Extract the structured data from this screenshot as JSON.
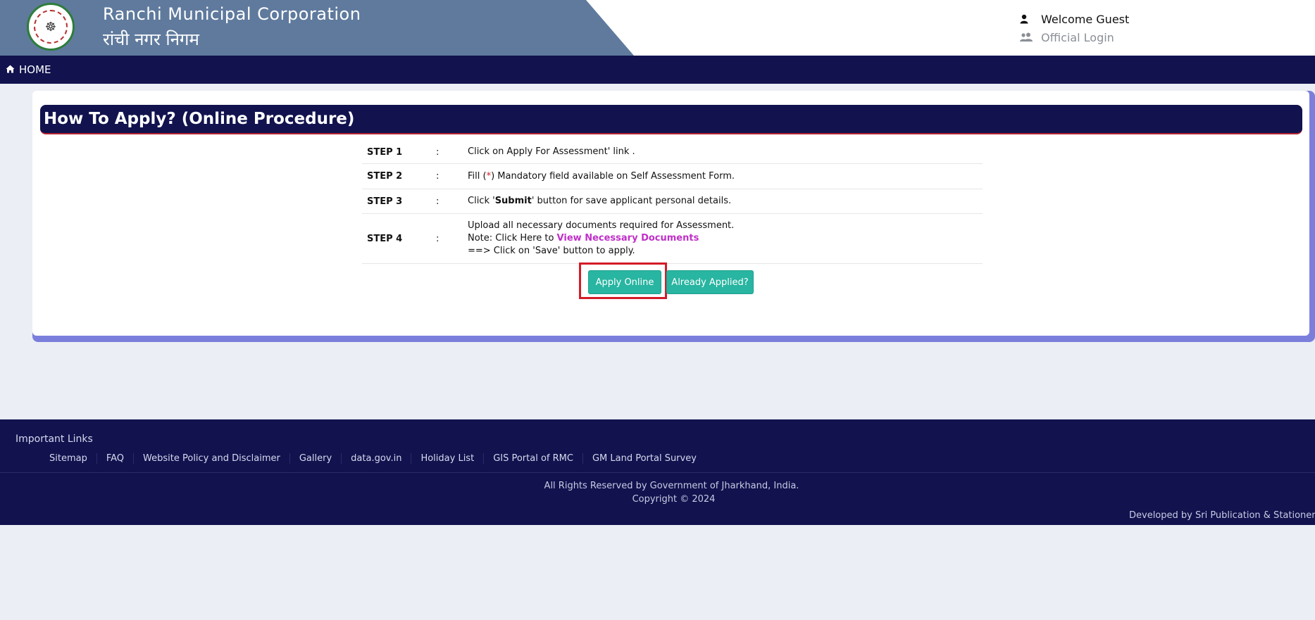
{
  "header": {
    "org_name_en": "Ranchi Municipal Corporation",
    "org_name_hi": "रांची नगर निगम",
    "welcome_text": "Welcome Guest",
    "login_text": "Official Login"
  },
  "nav": {
    "home_label": "HOME"
  },
  "main": {
    "title": "How To Apply? (Online Procedure)",
    "steps": [
      {
        "label": "STEP 1",
        "sep": ":",
        "text": "Click on Apply For Assessment' link ."
      },
      {
        "label": "STEP 2",
        "sep": ":",
        "text_before": "Fill (",
        "star": "*",
        "text_after": ") Mandatory field available on Self Assessment Form."
      },
      {
        "label": "STEP 3",
        "sep": ":",
        "text_before": "Click '",
        "bold": "Submit",
        "text_after": "' button for save applicant personal details."
      },
      {
        "label": "STEP 4",
        "sep": ":",
        "line1": "Upload all necessary documents required for Assessment.",
        "line2_prefix": "Note: Click Here to ",
        "link": "View Necessary Documents",
        "line3": "==> Click on 'Save' button to apply."
      }
    ],
    "apply_button": "Apply Online",
    "already_button": "Already Applied?"
  },
  "footer": {
    "heading": "Important Links",
    "links": [
      "Sitemap",
      "FAQ",
      "Website Policy and Disclaimer",
      "Gallery",
      "data.gov.in",
      "Holiday List",
      "GIS Portal of RMC",
      "GM Land Portal Survey"
    ],
    "rights": "All Rights Reserved by Government of Jharkhand, India.",
    "copyright": "Copyright © 2024",
    "developer": "Developed by Sri Publication & Stationers Pvt. Ltd."
  },
  "colors": {
    "brand_band": "#5f7a9d",
    "navy": "#11124e",
    "button": "#28b5a1",
    "highlight": "#d41b27",
    "link": "#c02fc9"
  }
}
